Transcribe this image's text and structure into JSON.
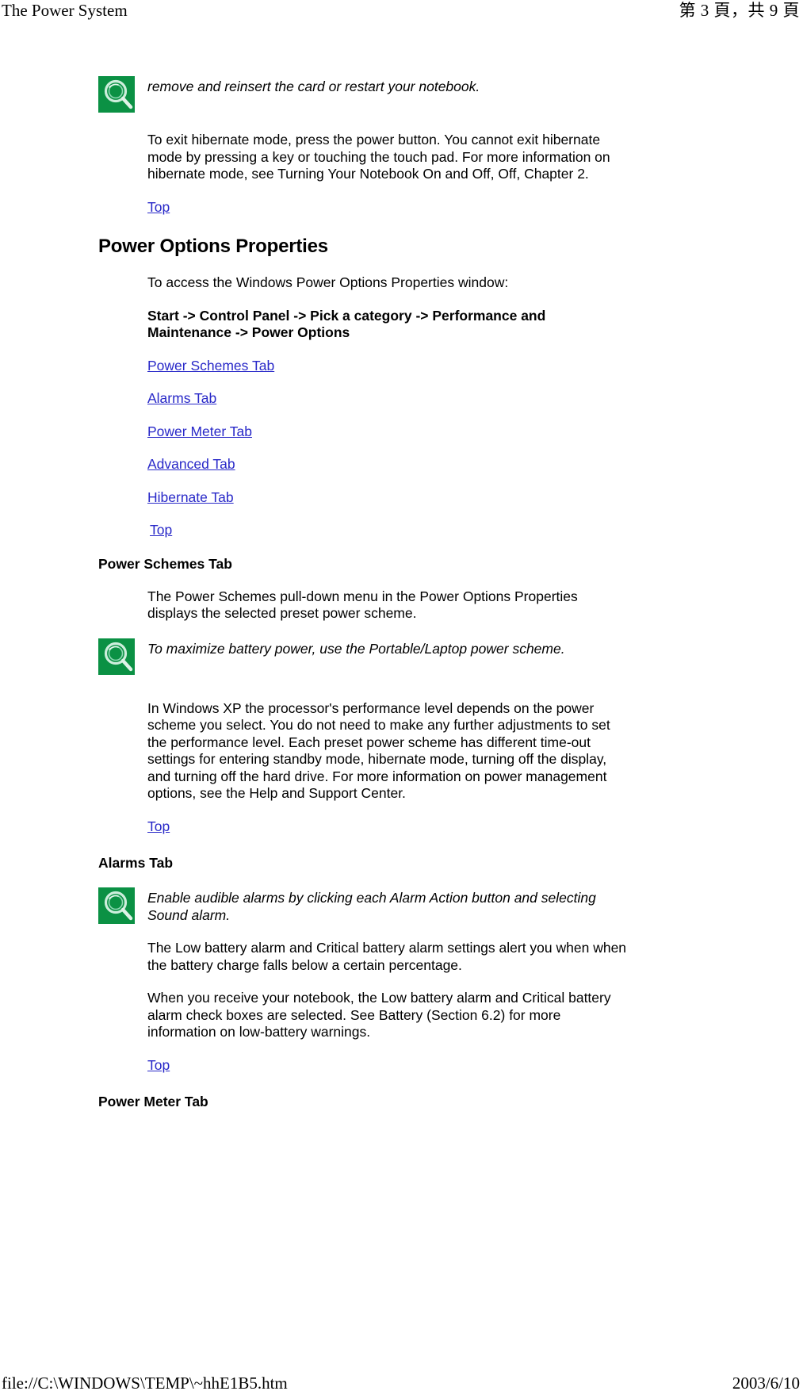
{
  "header": {
    "title": "The Power System",
    "page_indicator": "第 3 頁，共 9 頁"
  },
  "footer": {
    "file_path": "file://C:\\WINDOWS\\TEMP\\~hhE1B5.htm",
    "date": "2003/6/10"
  },
  "content": {
    "note_1": {
      "icon": "magnifier-note-icon",
      "text": "remove and reinsert the card or restart your notebook."
    },
    "para_hibernate_exit": "To exit hibernate mode, press the power button. You cannot exit hibernate mode by pressing a key or touching the touch pad. For more information on hibernate mode, see Turning Your Notebook On and Off, Off, Chapter 2.",
    "top_link_1": "Top",
    "section_title": "Power Options Properties",
    "para_access": "To access the Windows Power Options Properties window:",
    "para_path": "Start -> Control Panel -> Pick a category -> Performance and Maintenance -> Power Options",
    "tab_links": [
      "Power Schemes Tab",
      "Alarms Tab",
      "Power Meter Tab",
      "Advanced Tab",
      "Hibernate Tab"
    ],
    "top_link_2": "Top",
    "power_schemes_heading": "Power Schemes Tab",
    "para_power_schemes": "The Power Schemes pull-down menu in the Power Options Properties displays the selected preset power scheme.",
    "note_2": {
      "icon": "magnifier-note-icon",
      "text": "To maximize battery power, use the Portable/Laptop power scheme."
    },
    "para_winxp": "In Windows XP the processor's performance level depends on the power scheme you select. You do not need to make any further adjustments to set the performance level. Each preset power scheme has different time-out settings for entering standby mode, hibernate mode, turning off the display, and turning off the hard drive. For more information on power management options, see the Help and Support Center.",
    "top_link_3": "Top",
    "alarms_heading": "Alarms Tab",
    "note_3": {
      "icon": "magnifier-note-icon",
      "text": "Enable audible alarms by clicking each Alarm Action button and selecting Sound alarm."
    },
    "para_alarms_1": "The Low battery alarm and Critical battery alarm settings alert you when when the battery charge falls below a certain percentage.",
    "para_alarms_2": "When you receive your notebook, the Low battery alarm and Critical battery alarm check boxes are selected. See Battery (Section 6.2) for more information on low-battery warnings.",
    "top_link_4": "Top",
    "power_meter_heading": "Power Meter Tab"
  },
  "colors": {
    "link": "#2828c8",
    "note_icon_bg": "#0b9144",
    "text": "#000000"
  }
}
